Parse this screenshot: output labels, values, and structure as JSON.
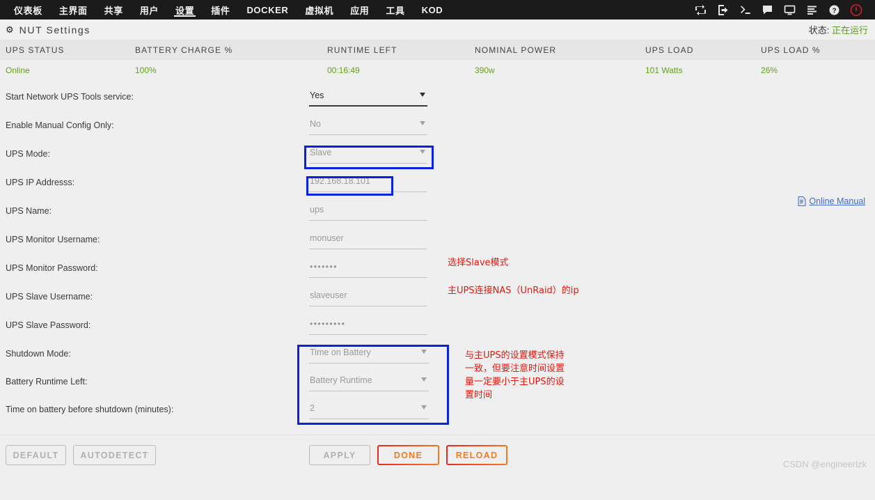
{
  "nav": {
    "items": [
      {
        "label": "仪表板",
        "active": false
      },
      {
        "label": "主界面",
        "active": false
      },
      {
        "label": "共享",
        "active": false
      },
      {
        "label": "用户",
        "active": false
      },
      {
        "label": "设置",
        "active": true
      },
      {
        "label": "插件",
        "active": false
      },
      {
        "label": "DOCKER",
        "active": false
      },
      {
        "label": "虚拟机",
        "active": false
      },
      {
        "label": "应用",
        "active": false
      },
      {
        "label": "工具",
        "active": false
      },
      {
        "label": "KOD",
        "active": false
      }
    ],
    "icons": [
      "sync-icon",
      "logout-icon",
      "terminal-icon",
      "chat-icon",
      "display-icon",
      "log-icon",
      "help-icon",
      "power-icon"
    ]
  },
  "header": {
    "icon": "gear-icon",
    "title": "NUT Settings",
    "state_label": "状态:",
    "state_value": "正在运行",
    "state_color": "#5a9a16"
  },
  "status_table": {
    "columns": [
      "UPS STATUS",
      "BATTERY CHARGE %",
      "RUNTIME LEFT",
      "NOMINAL POWER",
      "UPS LOAD",
      "UPS LOAD %"
    ],
    "values": [
      "Online",
      "100%",
      "00:16:49",
      "390w",
      "101 Watts",
      "26%"
    ],
    "value_color": "#62a312"
  },
  "manual_link": {
    "label": "Online Manual",
    "icon": "document-icon"
  },
  "form": {
    "rows": [
      {
        "label": "Start Network UPS Tools service:",
        "value": "Yes",
        "type": "select",
        "enabled": true
      },
      {
        "label": "Enable Manual Config Only:",
        "value": "No",
        "type": "select",
        "enabled": false
      },
      {
        "label": "UPS Mode:",
        "value": "Slave",
        "type": "select",
        "enabled": false
      },
      {
        "label": "UPS IP Addresss:",
        "value": "192.168.18.101",
        "type": "text",
        "enabled": false
      },
      {
        "label": "UPS Name:",
        "value": "ups",
        "type": "text",
        "enabled": false
      },
      {
        "label": "UPS Monitor Username:",
        "value": "monuser",
        "type": "text",
        "enabled": false
      },
      {
        "label": "UPS Monitor Password:",
        "value": "•••••••",
        "type": "password",
        "enabled": false
      },
      {
        "label": "UPS Slave Username:",
        "value": "slaveuser",
        "type": "text",
        "enabled": false
      },
      {
        "label": "UPS Slave Password:",
        "value": "•••••••••",
        "type": "password",
        "enabled": false
      },
      {
        "label": "Shutdown Mode:",
        "value": "Time on Battery",
        "type": "select",
        "enabled": false
      },
      {
        "label": "Battery Runtime Left:",
        "value": "Battery Runtime",
        "type": "select",
        "enabled": false
      },
      {
        "label": "Time on battery before shutdown (minutes):",
        "value": "2",
        "type": "select",
        "enabled": false
      }
    ]
  },
  "annotations": {
    "highlight_color": "#0b23e0",
    "text_color": "#e8160c",
    "notes": [
      "选择Slave模式",
      "主UPS连接NAS（UnRaid）的ip",
      "与主UPS的设置模式保持\n一致，但要注意时间设置\n量一定要小于主UPS的设\n置时间"
    ]
  },
  "footer": {
    "buttons": [
      {
        "label": "DEFAULT",
        "style": "grey"
      },
      {
        "label": "AUTODETECT",
        "style": "grey"
      },
      {
        "label": "APPLY",
        "style": "grey"
      },
      {
        "label": "DONE",
        "style": "accent"
      },
      {
        "label": "RELOAD",
        "style": "accent"
      }
    ],
    "watermark": "CSDN @engineerlzk"
  }
}
